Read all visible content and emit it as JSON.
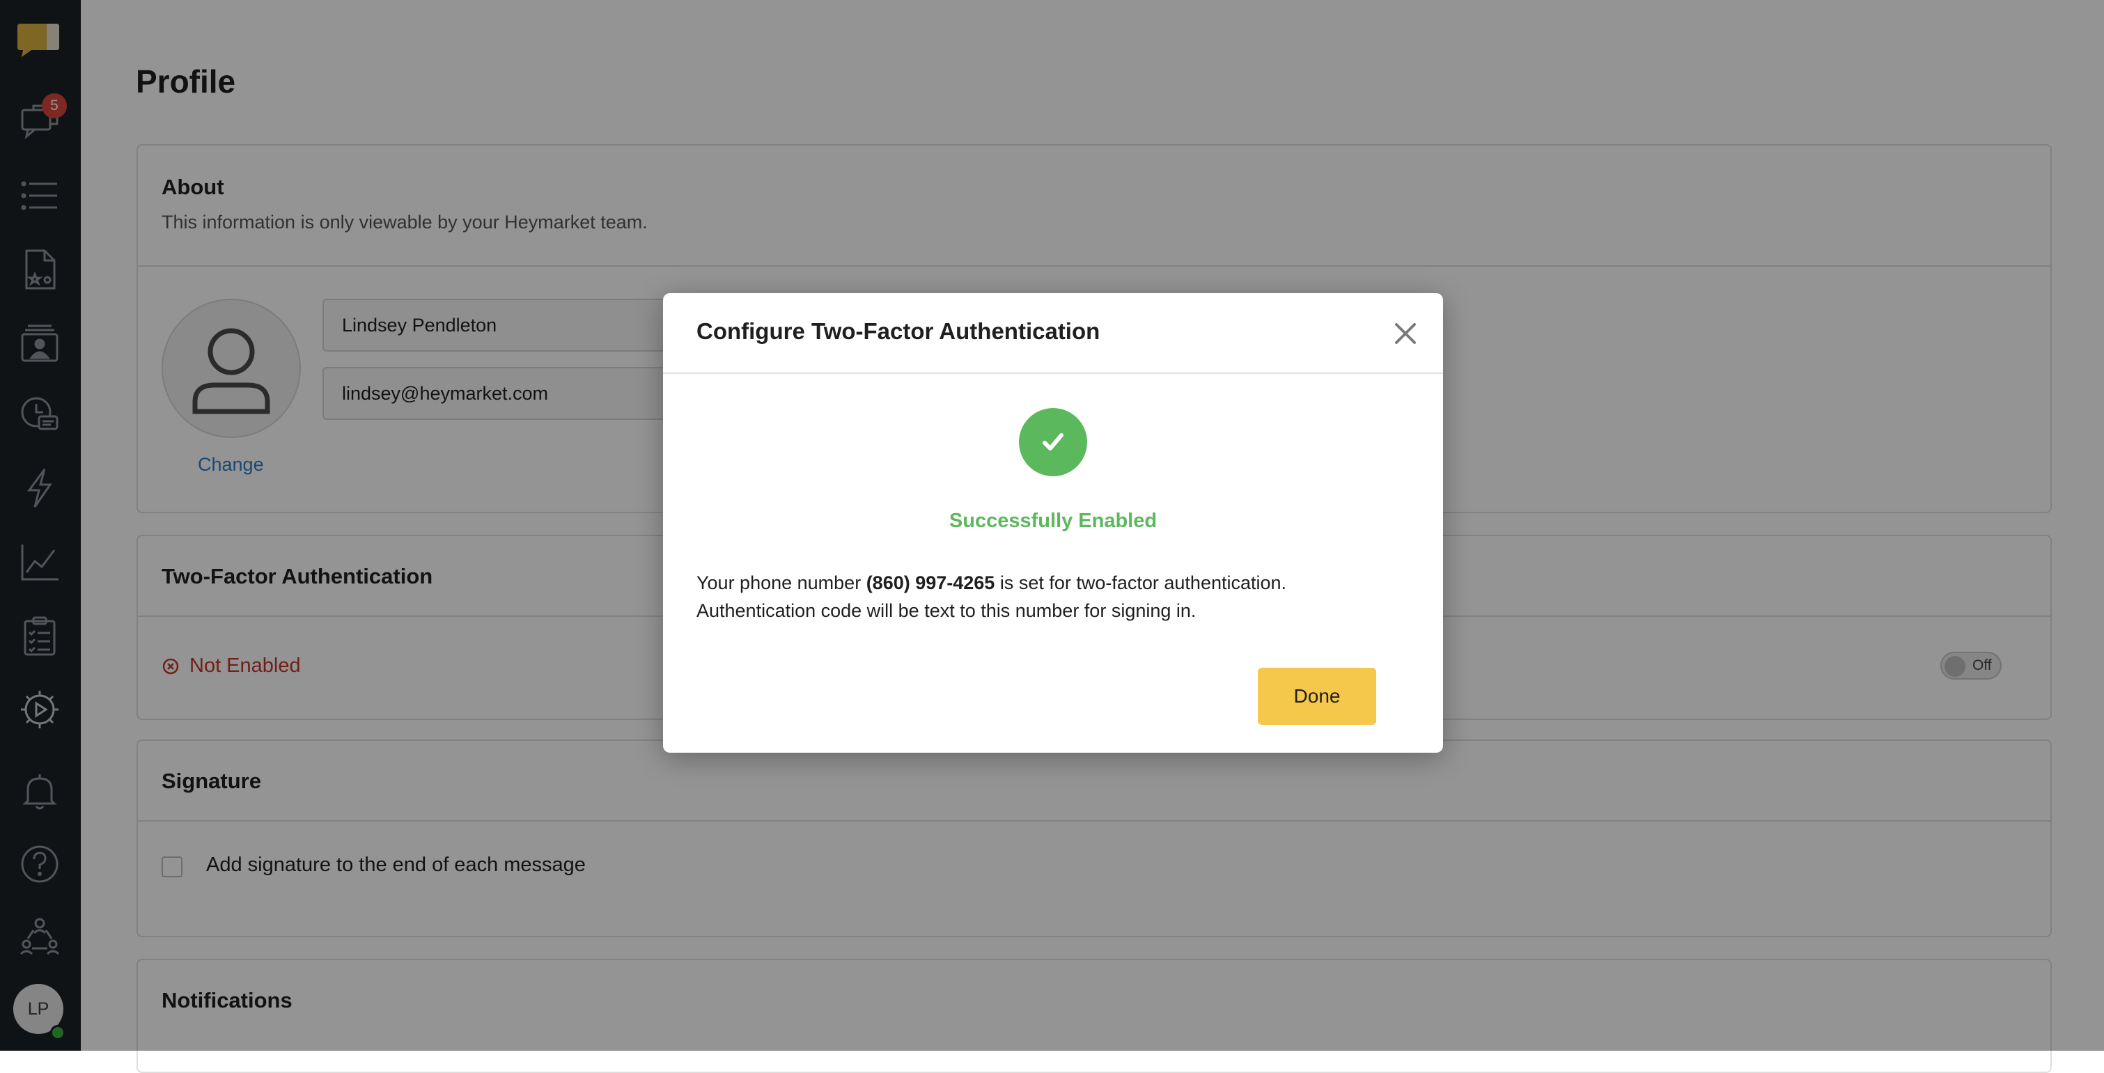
{
  "sidebar": {
    "badge_count": "5",
    "user_initials": "LP",
    "items": [
      {
        "icon": "chat-bubbles-icon"
      },
      {
        "icon": "list-icon"
      },
      {
        "icon": "document-star-icon"
      },
      {
        "icon": "contacts-icon"
      },
      {
        "icon": "clock-message-icon"
      },
      {
        "icon": "lightning-icon"
      },
      {
        "icon": "line-chart-icon"
      },
      {
        "icon": "clipboard-checklist-icon"
      },
      {
        "icon": "gear-play-icon"
      },
      {
        "icon": "bell-icon"
      },
      {
        "icon": "help-icon"
      },
      {
        "icon": "team-network-icon"
      }
    ]
  },
  "page": {
    "title": "Profile"
  },
  "about": {
    "title": "About",
    "description": "This information is only viewable by your Heymarket team.",
    "name_value": "Lindsey Pendleton",
    "email_value": "lindsey@heymarket.com",
    "change_link": "Change"
  },
  "two_factor": {
    "title": "Two-Factor Authentication",
    "status": "Not Enabled",
    "toggle_label": "Off"
  },
  "signature": {
    "title": "Signature",
    "checkbox_label": "Add signature to the end of each message"
  },
  "notifications": {
    "title": "Notifications"
  },
  "modal": {
    "title": "Configure Two-Factor Authentication",
    "success_text": "Successfully Enabled",
    "body_prefix": "Your phone number ",
    "phone": "(860) 997-4265",
    "body_suffix": " is set for two-factor authentication.",
    "body_line2": "Authentication code will be text to this number for signing in.",
    "done_label": "Done"
  },
  "colors": {
    "sidebar_bg": "#1c2127",
    "success_green": "#5cb85c",
    "done_button": "#f5c84c",
    "error_red": "#c0392b",
    "link_blue": "#2d7fc9"
  }
}
